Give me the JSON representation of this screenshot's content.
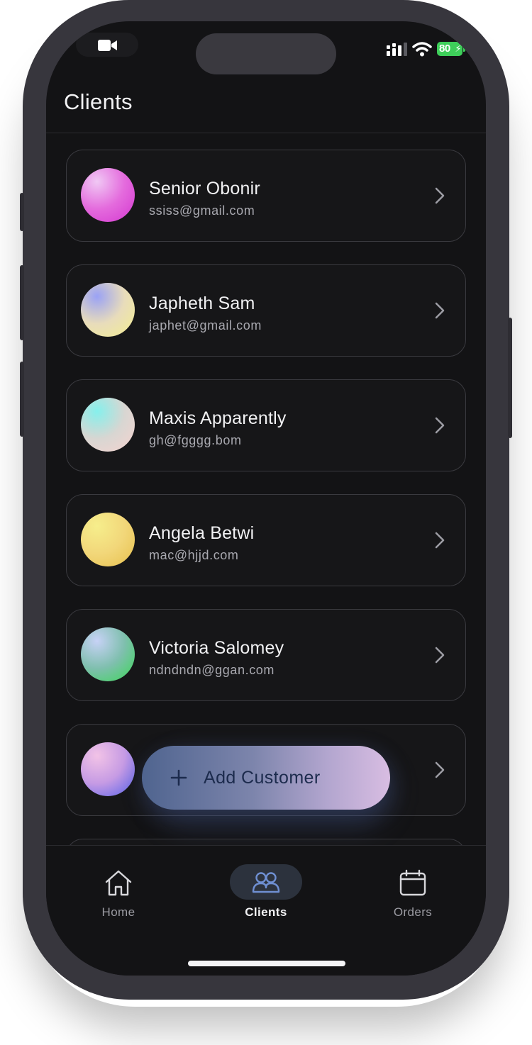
{
  "status_bar": {
    "battery": "80",
    "icons": [
      "video-camera-icon",
      "signal-icon",
      "wifi-icon",
      "battery-icon"
    ]
  },
  "header": {
    "title": "Clients"
  },
  "clients": [
    {
      "name": "Senior Obonir",
      "email": "ssiss@gmail.com",
      "avatar_colors": [
        "#f0c8f4",
        "#e46bdd",
        "#d437d0"
      ]
    },
    {
      "name": "Japheth Sam",
      "email": "japhet@gmail.com",
      "avatar_colors": [
        "#9aa2f5",
        "#e8dcbb",
        "#f3ee90"
      ]
    },
    {
      "name": "Maxis Apparently",
      "email": "gh@fgggg.bom",
      "avatar_colors": [
        "#86f0ec",
        "#d8d6d2",
        "#f6d3cf"
      ]
    },
    {
      "name": "Angela Betwi",
      "email": "mac@hjjd.com",
      "avatar_colors": [
        "#f6ee8c",
        "#f2d77a",
        "#e7c04d"
      ]
    },
    {
      "name": "Victoria Salomey",
      "email": "ndndndn@ggan.com",
      "avatar_colors": [
        "#c7d2f6",
        "#7fbfae",
        "#3bd856"
      ]
    },
    {
      "name": "",
      "email": "",
      "avatar_colors": [
        "#f2c3e6",
        "#c69be4",
        "#5662ea"
      ]
    }
  ],
  "add_button": {
    "label": "Add Customer"
  },
  "tabs": [
    {
      "label": "Home",
      "icon": "home-icon",
      "active": false
    },
    {
      "label": "Clients",
      "icon": "users-icon",
      "active": true
    },
    {
      "label": "Orders",
      "icon": "calendar-icon",
      "active": false
    }
  ],
  "colors": {
    "background": "#131315",
    "card_border": "#3a3a3f",
    "accent_pill": "#2c323d",
    "fab_gradient": [
      "#4f648f",
      "#d8bde2"
    ]
  }
}
